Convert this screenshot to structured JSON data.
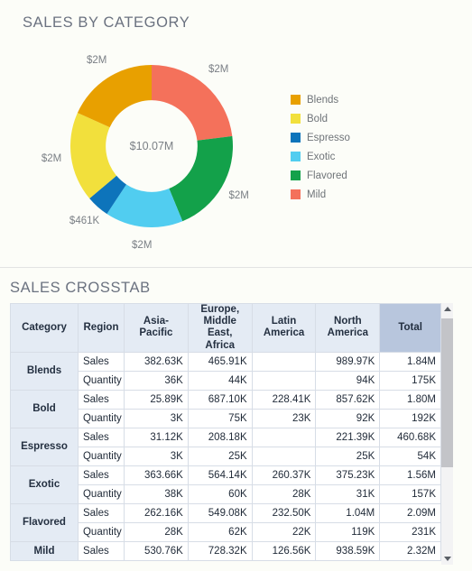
{
  "chart_panel": {
    "title": "SALES BY CATEGORY",
    "center_total": "$10.07M"
  },
  "table_panel": {
    "title": "SALES CROSSTAB"
  },
  "legend": {
    "items": [
      {
        "label": "Blends",
        "color": "#e8a000"
      },
      {
        "label": "Bold",
        "color": "#f2e03c"
      },
      {
        "label": "Espresso",
        "color": "#0d74bb"
      },
      {
        "label": "Exotic",
        "color": "#51cdf0"
      },
      {
        "label": "Flavored",
        "color": "#13a14a"
      },
      {
        "label": "Mild",
        "color": "#f4715b"
      }
    ]
  },
  "chart_data": {
    "type": "pie",
    "title": "SALES BY CATEGORY",
    "subtype": "donut",
    "center_label": "$10.07M",
    "total": 10070000,
    "legend_position": "right",
    "categories": [
      "Blends",
      "Bold",
      "Espresso",
      "Exotic",
      "Flavored",
      "Mild"
    ],
    "values": [
      1840000,
      1800000,
      461000,
      1560000,
      2090000,
      2320000
    ],
    "value_labels": [
      "$2M",
      "$2M",
      "$461K",
      "$2M",
      "$2M",
      "$2M"
    ],
    "colors": [
      "#e8a000",
      "#f2e03c",
      "#0d74bb",
      "#51cdf0",
      "#13a14a",
      "#f4715b"
    ],
    "draw_order": [
      "Mild",
      "Flavored",
      "Exotic",
      "Espresso",
      "Bold",
      "Blends"
    ],
    "start_angle_deg": 0,
    "direction": "clockwise",
    "inner_radius_ratio": 0.565
  },
  "crosstab": {
    "columns": [
      "Category",
      "Region",
      "Asia-Pacific",
      "Europe, Middle East, Africa",
      "Latin America",
      "North America",
      "Total"
    ],
    "rows": [
      {
        "category": "Blends",
        "measure": "Sales",
        "asia_pacific": "382.63K",
        "emea": "465.91K",
        "latin_america": "",
        "north_america": "989.97K",
        "total": "1.84M"
      },
      {
        "category": "Blends",
        "measure": "Quantity",
        "asia_pacific": "36K",
        "emea": "44K",
        "latin_america": "",
        "north_america": "94K",
        "total": "175K"
      },
      {
        "category": "Bold",
        "measure": "Sales",
        "asia_pacific": "25.89K",
        "emea": "687.10K",
        "latin_america": "228.41K",
        "north_america": "857.62K",
        "total": "1.80M"
      },
      {
        "category": "Bold",
        "measure": "Quantity",
        "asia_pacific": "3K",
        "emea": "75K",
        "latin_america": "23K",
        "north_america": "92K",
        "total": "192K"
      },
      {
        "category": "Espresso",
        "measure": "Sales",
        "asia_pacific": "31.12K",
        "emea": "208.18K",
        "latin_america": "",
        "north_america": "221.39K",
        "total": "460.68K"
      },
      {
        "category": "Espresso",
        "measure": "Quantity",
        "asia_pacific": "3K",
        "emea": "25K",
        "latin_america": "",
        "north_america": "25K",
        "total": "54K"
      },
      {
        "category": "Exotic",
        "measure": "Sales",
        "asia_pacific": "363.66K",
        "emea": "564.14K",
        "latin_america": "260.37K",
        "north_america": "375.23K",
        "total": "1.56M"
      },
      {
        "category": "Exotic",
        "measure": "Quantity",
        "asia_pacific": "38K",
        "emea": "60K",
        "latin_america": "28K",
        "north_america": "31K",
        "total": "157K"
      },
      {
        "category": "Flavored",
        "measure": "Sales",
        "asia_pacific": "262.16K",
        "emea": "549.08K",
        "latin_america": "232.50K",
        "north_america": "1.04M",
        "total": "2.09M"
      },
      {
        "category": "Flavored",
        "measure": "Quantity",
        "asia_pacific": "28K",
        "emea": "62K",
        "latin_america": "22K",
        "north_america": "119K",
        "total": "231K"
      },
      {
        "category": "Mild",
        "measure": "Sales",
        "asia_pacific": "530.76K",
        "emea": "728.32K",
        "latin_america": "126.56K",
        "north_america": "938.59K",
        "total": "2.32M"
      }
    ]
  },
  "scrollbar": {
    "up_icon": "triangle-up-icon",
    "down_icon": "triangle-down-icon"
  }
}
